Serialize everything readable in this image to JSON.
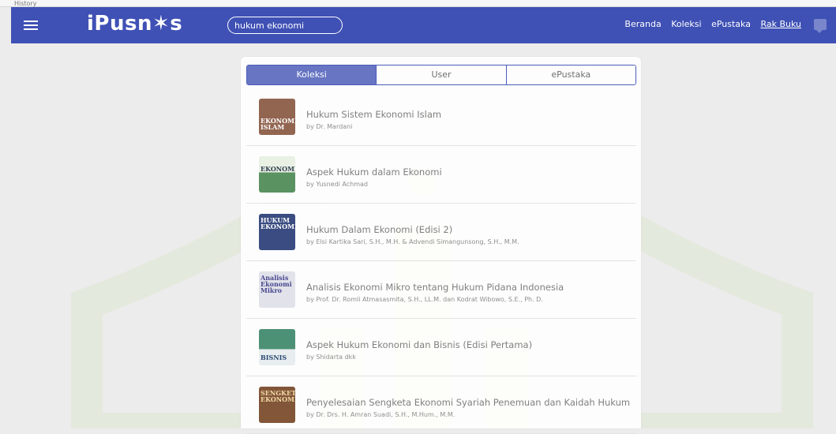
{
  "window": {
    "title": "History"
  },
  "navbar": {
    "logo": "iPusn✶s",
    "search_value": "hukum ekonomi",
    "links": [
      "Beranda",
      "Koleksi",
      "ePustaka",
      "Rak Buku"
    ],
    "active_link": "Rak Buku",
    "bg_color": "#3f51b5"
  },
  "tabs": [
    {
      "label": "Koleksi",
      "active": true
    },
    {
      "label": "User",
      "active": false
    },
    {
      "label": "ePustaka",
      "active": false
    }
  ],
  "results": [
    {
      "title": "Hukum Sistem Ekonomi Islam",
      "author": "by Dr. Mardani",
      "cover_color": "#8b5a44",
      "cover_text": "EKONOMI ISLAM"
    },
    {
      "title": "Aspek Hukum dalam Ekonomi",
      "author": "by Yusnedi Achmad",
      "cover_color": "#4e8b57",
      "cover_text": "EKONOMI"
    },
    {
      "title": "Hukum Dalam Ekonomi (Edisi 2)",
      "author": "by Elsi Kartika Sari, S.H., M.H. & Advendi Simangunsong, S.H., M.M.",
      "cover_color": "#2c3f7a",
      "cover_text": "HUKUM EKONOMI"
    },
    {
      "title": "Analisis Ekonomi Mikro tentang Hukum Pidana Indonesia",
      "author": "by Prof. Dr. Romli Atmasasmita, S.H., LL.M. dan Kodrat Wibowo, S.E., Ph. D.",
      "cover_color": "#c8c8d4",
      "cover_text": "Analisis Ekonomi Mikro"
    },
    {
      "title": "Aspek Hukum Ekonomi dan Bisnis (Edisi Pertama)",
      "author": "by Shidarta dkk",
      "cover_color": "#3f8a6c",
      "cover_text": "BISNIS"
    },
    {
      "title": "Penyelesaian Sengketa Ekonomi Syariah Penemuan dan Kaidah Hukum",
      "author": "by Dr. Drs. H. Amran Suadi, S.H., M.Hum., M.M.",
      "cover_color": "#7a4a2a",
      "cover_text": "SENGKETA EKONOMI"
    }
  ]
}
